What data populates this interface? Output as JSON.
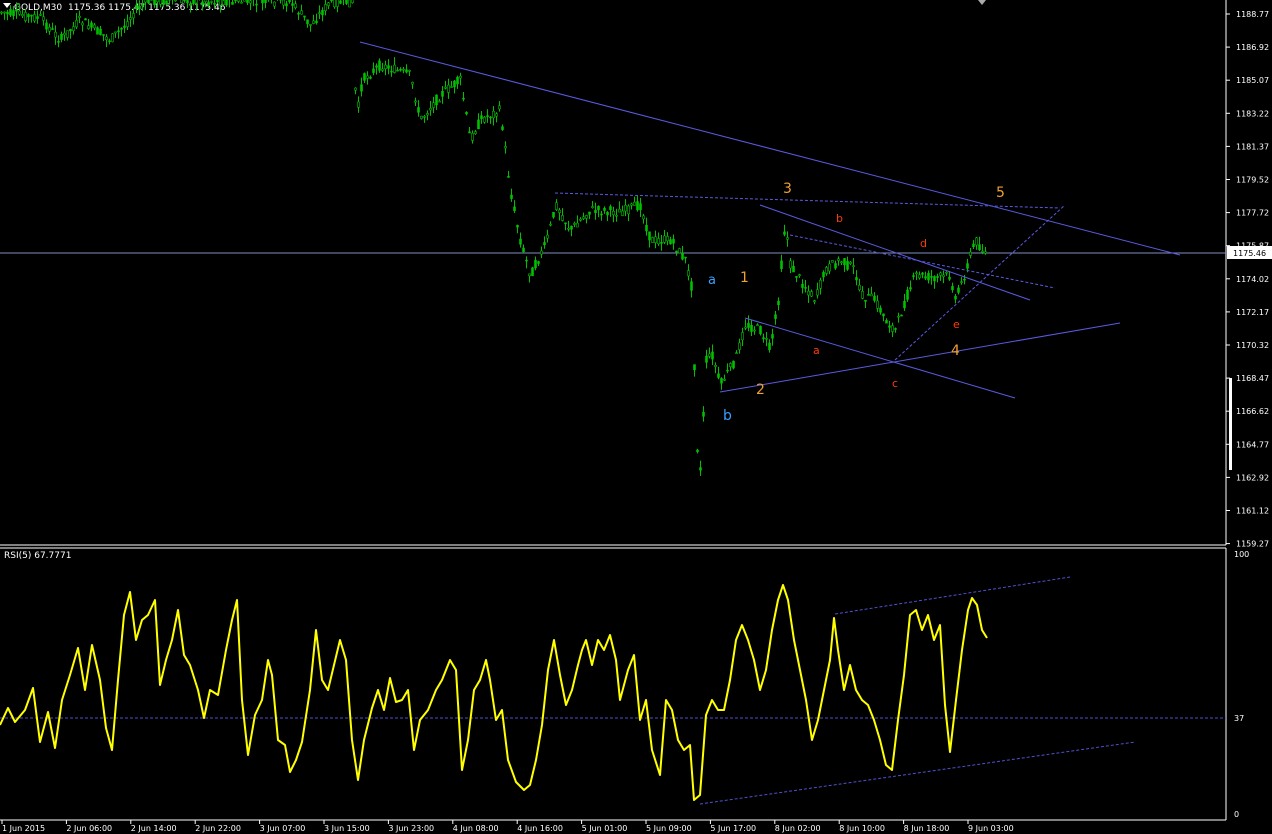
{
  "header": {
    "symbol": "GOLD,M30",
    "ohlc": "1175.36 1175.47 1175.36 1175.46"
  },
  "price_axis": {
    "ticks": [
      "1188.77",
      "1186.92",
      "1185.07",
      "1183.22",
      "1181.37",
      "1179.52",
      "1177.72",
      "1175.87",
      "1174.02",
      "1172.17",
      "1170.32",
      "1168.47",
      "1166.62",
      "1164.77",
      "1162.92",
      "1161.12",
      "1159.27"
    ],
    "current": "1175.46"
  },
  "time_axis": {
    "ticks": [
      "1 Jun 2015",
      "2 Jun 06:00",
      "2 Jun 14:00",
      "2 Jun 22:00",
      "3 Jun 07:00",
      "3 Jun 15:00",
      "3 Jun 23:00",
      "4 Jun 08:00",
      "4 Jun 16:00",
      "5 Jun 01:00",
      "5 Jun 09:00",
      "5 Jun 17:00",
      "8 Jun 02:00",
      "8 Jun 10:00",
      "8 Jun 18:00",
      "9 Jun 03:00"
    ]
  },
  "indicator": {
    "title": "RSI(5) 67.7771",
    "levels": [
      "100",
      "37",
      "0"
    ]
  },
  "wave_labels": [
    {
      "text": "3",
      "color": "#f0a030"
    },
    {
      "text": "5",
      "color": "#f0a030"
    },
    {
      "text": "b",
      "color": "#ff3a10"
    },
    {
      "text": "d",
      "color": "#ff3a10"
    },
    {
      "text": "a",
      "color": "#3aa0ff"
    },
    {
      "text": "1",
      "color": "#f0a030"
    },
    {
      "text": "a",
      "color": "#ff3a10"
    },
    {
      "text": "e",
      "color": "#ff3a10"
    },
    {
      "text": "4",
      "color": "#f0a030"
    },
    {
      "text": "2",
      "color": "#f0a030"
    },
    {
      "text": "c",
      "color": "#ff3a10"
    },
    {
      "text": "b",
      "color": "#3aa0ff"
    }
  ],
  "colors": {
    "candles": "#00c000",
    "rsi": "#ffff00",
    "trendlines": "#5050e0",
    "axis": "#ffffff",
    "grid_text": "#ffffff"
  }
}
